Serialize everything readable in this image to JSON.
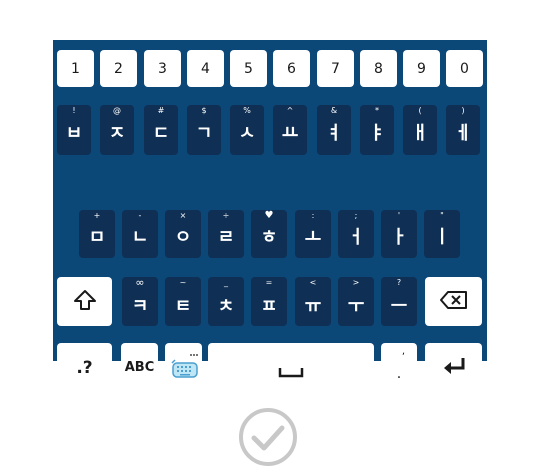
{
  "keyboard": {
    "number_row": [
      "1",
      "2",
      "3",
      "4",
      "5",
      "6",
      "7",
      "8",
      "9",
      "0"
    ],
    "row1": [
      {
        "main": "ㅂ",
        "hint": "!"
      },
      {
        "main": "ㅈ",
        "hint": "@"
      },
      {
        "main": "ㄷ",
        "hint": "#"
      },
      {
        "main": "ㄱ",
        "hint": "$"
      },
      {
        "main": "ㅅ",
        "hint": "%"
      },
      {
        "main": "ㅛ",
        "hint": "^"
      },
      {
        "main": "ㅕ",
        "hint": "&"
      },
      {
        "main": "ㅑ",
        "hint": "*"
      },
      {
        "main": "ㅐ",
        "hint": "("
      },
      {
        "main": "ㅔ",
        "hint": ")"
      }
    ],
    "row2": [
      {
        "main": "ㅁ",
        "hint": "+"
      },
      {
        "main": "ㄴ",
        "hint": "-"
      },
      {
        "main": "ㅇ",
        "hint": "×"
      },
      {
        "main": "ㄹ",
        "hint": "÷"
      },
      {
        "main": "ㅎ",
        "hint": "♥"
      },
      {
        "main": "ㅗ",
        "hint": ":"
      },
      {
        "main": "ㅓ",
        "hint": ";"
      },
      {
        "main": "ㅏ",
        "hint": "'"
      },
      {
        "main": "ㅣ",
        "hint": "\""
      }
    ],
    "row3": [
      {
        "main": "ㅋ",
        "hint": "∞"
      },
      {
        "main": "ㅌ",
        "hint": "~"
      },
      {
        "main": "ㅊ",
        "hint": "_"
      },
      {
        "main": "ㅍ",
        "hint": "="
      },
      {
        "main": "ㅠ",
        "hint": "<"
      },
      {
        "main": "ㅜ",
        "hint": ">"
      },
      {
        "main": "ㅡ",
        "hint": "?"
      }
    ],
    "bottom": {
      "symbols_label": ".?",
      "abc_label": "ABC",
      "period_label": ".",
      "period_hint": ","
    },
    "icons": {
      "shift": "shift-arrow-icon",
      "backspace": "backspace-icon",
      "settings": "keyboard-settings-icon",
      "space": "space-bar-icon",
      "enter": "enter-arrow-icon",
      "confirm": "checkmark-circle-icon"
    }
  },
  "colors": {
    "keyboard_bg": "#0b4777",
    "dark_key": "#0f2f55",
    "light_key": "#ffffff",
    "check_gray": "#c8c8c8"
  }
}
